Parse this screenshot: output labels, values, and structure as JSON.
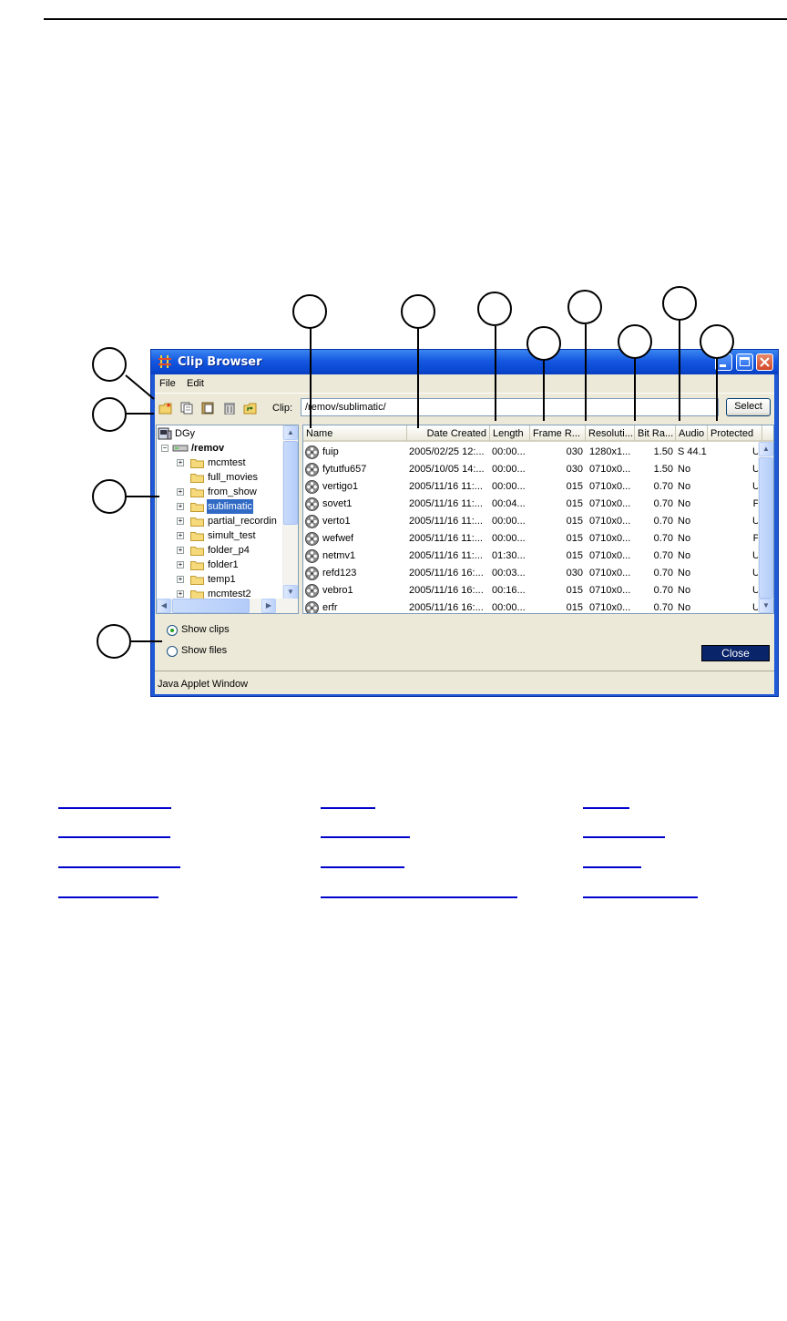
{
  "window": {
    "title": "Clip Browser",
    "colors": {
      "titlebar": "#0a4ad3",
      "selection": "#316ac5",
      "face": "#ece9d8",
      "close_button": "#0a246a"
    }
  },
  "menu": {
    "file": "File",
    "edit": "Edit"
  },
  "toolbar": {
    "icons": [
      "new-folder-icon",
      "copy-icon",
      "paste-icon",
      "delete-icon",
      "up-folder-icon"
    ],
    "clip_label": "Clip:",
    "clip_value": "/remov/sublimatic/",
    "select_label": "Select"
  },
  "tree": {
    "root": "DGy",
    "drive": "/remov",
    "folders": [
      "mcmtest",
      "full_movies",
      "from_show",
      "sublimatic",
      "partial_recordin",
      "simult_test",
      "folder_p4",
      "folder1",
      "temp1",
      "mcmtest2"
    ],
    "selected": "sublimatic"
  },
  "table": {
    "columns": [
      "Name",
      "Date Created",
      "Length",
      "Frame R...",
      "Resoluti...",
      "Bit Ra...",
      "Audio",
      "Protected"
    ],
    "rows": [
      {
        "name": "fuip",
        "date": "2005/02/25 12:...",
        "length": "00:00...",
        "frame": "030",
        "res": "1280x1...",
        "bitrate": "1.50",
        "audio": "S 44.1",
        "prot": "U"
      },
      {
        "name": "fytutfu657",
        "date": "2005/10/05 14:...",
        "length": "00:00...",
        "frame": "030",
        "res": "0710x0...",
        "bitrate": "1.50",
        "audio": "No",
        "prot": "U"
      },
      {
        "name": "vertigo1",
        "date": "2005/11/16 11:...",
        "length": "00:00...",
        "frame": "015",
        "res": "0710x0...",
        "bitrate": "0.70",
        "audio": "No",
        "prot": "U"
      },
      {
        "name": "sovet1",
        "date": "2005/11/16 11:...",
        "length": "00:04...",
        "frame": "015",
        "res": "0710x0...",
        "bitrate": "0.70",
        "audio": "No",
        "prot": "P"
      },
      {
        "name": "verto1",
        "date": "2005/11/16 11:...",
        "length": "00:00...",
        "frame": "015",
        "res": "0710x0...",
        "bitrate": "0.70",
        "audio": "No",
        "prot": "U"
      },
      {
        "name": "wefwef",
        "date": "2005/11/16 11:...",
        "length": "00:00...",
        "frame": "015",
        "res": "0710x0...",
        "bitrate": "0.70",
        "audio": "No",
        "prot": "P"
      },
      {
        "name": "netmv1",
        "date": "2005/11/16 11:...",
        "length": "01:30...",
        "frame": "015",
        "res": "0710x0...",
        "bitrate": "0.70",
        "audio": "No",
        "prot": "U"
      },
      {
        "name": "refd123",
        "date": "2005/11/16 16:...",
        "length": "00:03...",
        "frame": "030",
        "res": "0710x0...",
        "bitrate": "0.70",
        "audio": "No",
        "prot": "U"
      },
      {
        "name": "vebro1",
        "date": "2005/11/16 16:...",
        "length": "00:16...",
        "frame": "015",
        "res": "0710x0...",
        "bitrate": "0.70",
        "audio": "No",
        "prot": "U"
      },
      {
        "name": "erfr",
        "date": "2005/11/16 16:...",
        "length": "00:00...",
        "frame": "015",
        "res": "0710x0...",
        "bitrate": "0.70",
        "audio": "No",
        "prot": "U"
      }
    ]
  },
  "options": {
    "show_clips": "Show clips",
    "show_files": "Show files",
    "selected": "show_clips"
  },
  "close_label": "Close",
  "status": "Java Applet Window"
}
